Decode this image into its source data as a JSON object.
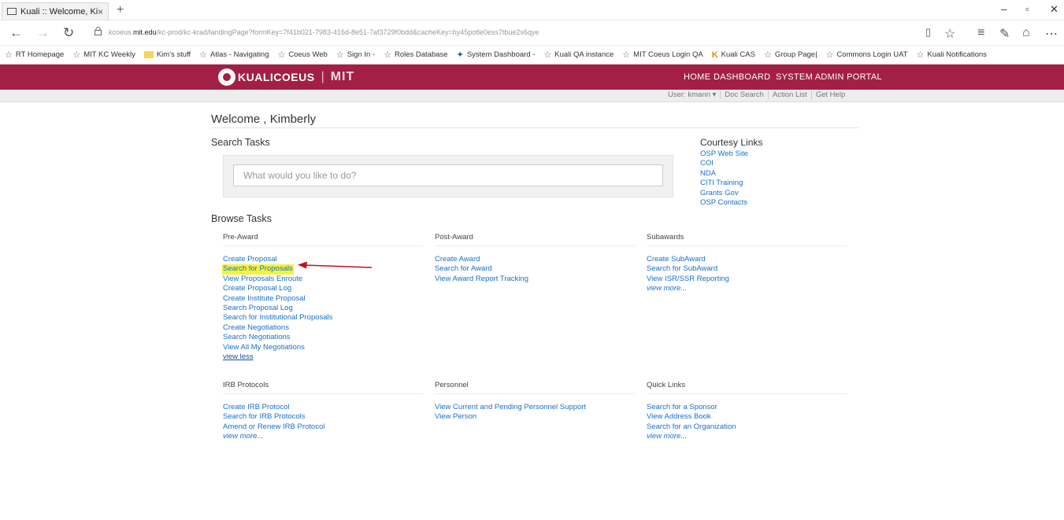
{
  "browser": {
    "tab_title": "Kuali :: Welcome, Kimbe",
    "tab_close": "×",
    "new_tab": "+",
    "url_prefix": "kcoeus.",
    "url_domain": "mit.edu",
    "url_rest": "/kc-prod/kc-krad/landingPage?formKey=7f41b021-7983-416d-8e51-7af3729f0bdd&cacheKey=hy45potle0ess7tbue2s6qye",
    "bookmarks": [
      {
        "label": "RT Homepage",
        "icon": "star-icon"
      },
      {
        "label": "MIT KC Weekly",
        "icon": "star-icon"
      },
      {
        "label": "Kim's stuff",
        "icon": "folder-icon"
      },
      {
        "label": "Atlas - Navigating",
        "icon": "star-icon"
      },
      {
        "label": "Coeus Web",
        "icon": "star-icon"
      },
      {
        "label": "Sign In -",
        "icon": "star-icon"
      },
      {
        "label": "Roles Database",
        "icon": "star-icon"
      },
      {
        "label": "System Dashboard -",
        "icon": "pin-icon"
      },
      {
        "label": "Kuali QA instance",
        "icon": "star-icon"
      },
      {
        "label": "MIT Coeus Login QA",
        "icon": "star-icon"
      },
      {
        "label": "Kuali CAS",
        "icon": "kuali-icon"
      },
      {
        "label": "Group Page|",
        "icon": "star-icon"
      },
      {
        "label": "Commons Login UAT",
        "icon": "star-icon"
      },
      {
        "label": "Kuali Notifications",
        "icon": "star-icon"
      }
    ]
  },
  "header": {
    "logo_text": "KUALICOEUS",
    "logo_sep": "|",
    "logo_mit": "MIT",
    "nav": {
      "home": "HOME",
      "dashboard": "DASHBOARD",
      "admin": "SYSTEM ADMIN PORTAL"
    },
    "userbar": {
      "user": "User: kmann ▾",
      "doc_search": "Doc Search",
      "action_list": "Action List",
      "get_help": "Get Help"
    }
  },
  "main": {
    "welcome": "Welcome , Kimberly",
    "search_tasks_title": "Search Tasks",
    "search_placeholder": "What would you like to do?",
    "browse_tasks_title": "Browse Tasks",
    "courtesy": {
      "title": "Courtesy Links",
      "links": [
        "OSP Web Site",
        "COI",
        "NDA",
        "CITI Training",
        "Grants Gov",
        "OSP Contacts"
      ]
    },
    "sections": {
      "pre_award": {
        "title": "Pre-Award",
        "links": [
          "Create Proposal",
          "Search for Proposals",
          "View Proposals Enroute",
          "Create Proposal Log",
          "Create Institute Proposal",
          "Search Proposal Log",
          "Search for Institutional Proposals",
          "Create Negotiations",
          "Search Negotiations",
          "View All My Negotiations"
        ],
        "toggle": "view less"
      },
      "post_award": {
        "title": "Post-Award",
        "links": [
          "Create Award",
          "Search for Award",
          "View Award Report Tracking"
        ]
      },
      "subawards": {
        "title": "Subawards",
        "links": [
          "Create SubAward",
          "Search for SubAward",
          "View ISR/SSR Reporting"
        ],
        "toggle": "view more..."
      },
      "irb": {
        "title": "IRB Protocols",
        "links": [
          "Create IRB Protocol",
          "Search for IRB Protocols",
          "Amend or Renew IRB Protocol"
        ],
        "toggle": "view more..."
      },
      "personnel": {
        "title": "Personnel",
        "links": [
          "View Current and Pending Personnel Support",
          "View Person"
        ]
      },
      "quick_links": {
        "title": "Quick Links",
        "links": [
          "Search for a Sponsor",
          "View Address Book",
          "Search for an Organization"
        ],
        "toggle": "view more..."
      }
    }
  },
  "colors": {
    "brand": "#a31f45",
    "link": "#1a6fc9",
    "highlight": "#f5f33a",
    "arrow": "#c0121f"
  }
}
